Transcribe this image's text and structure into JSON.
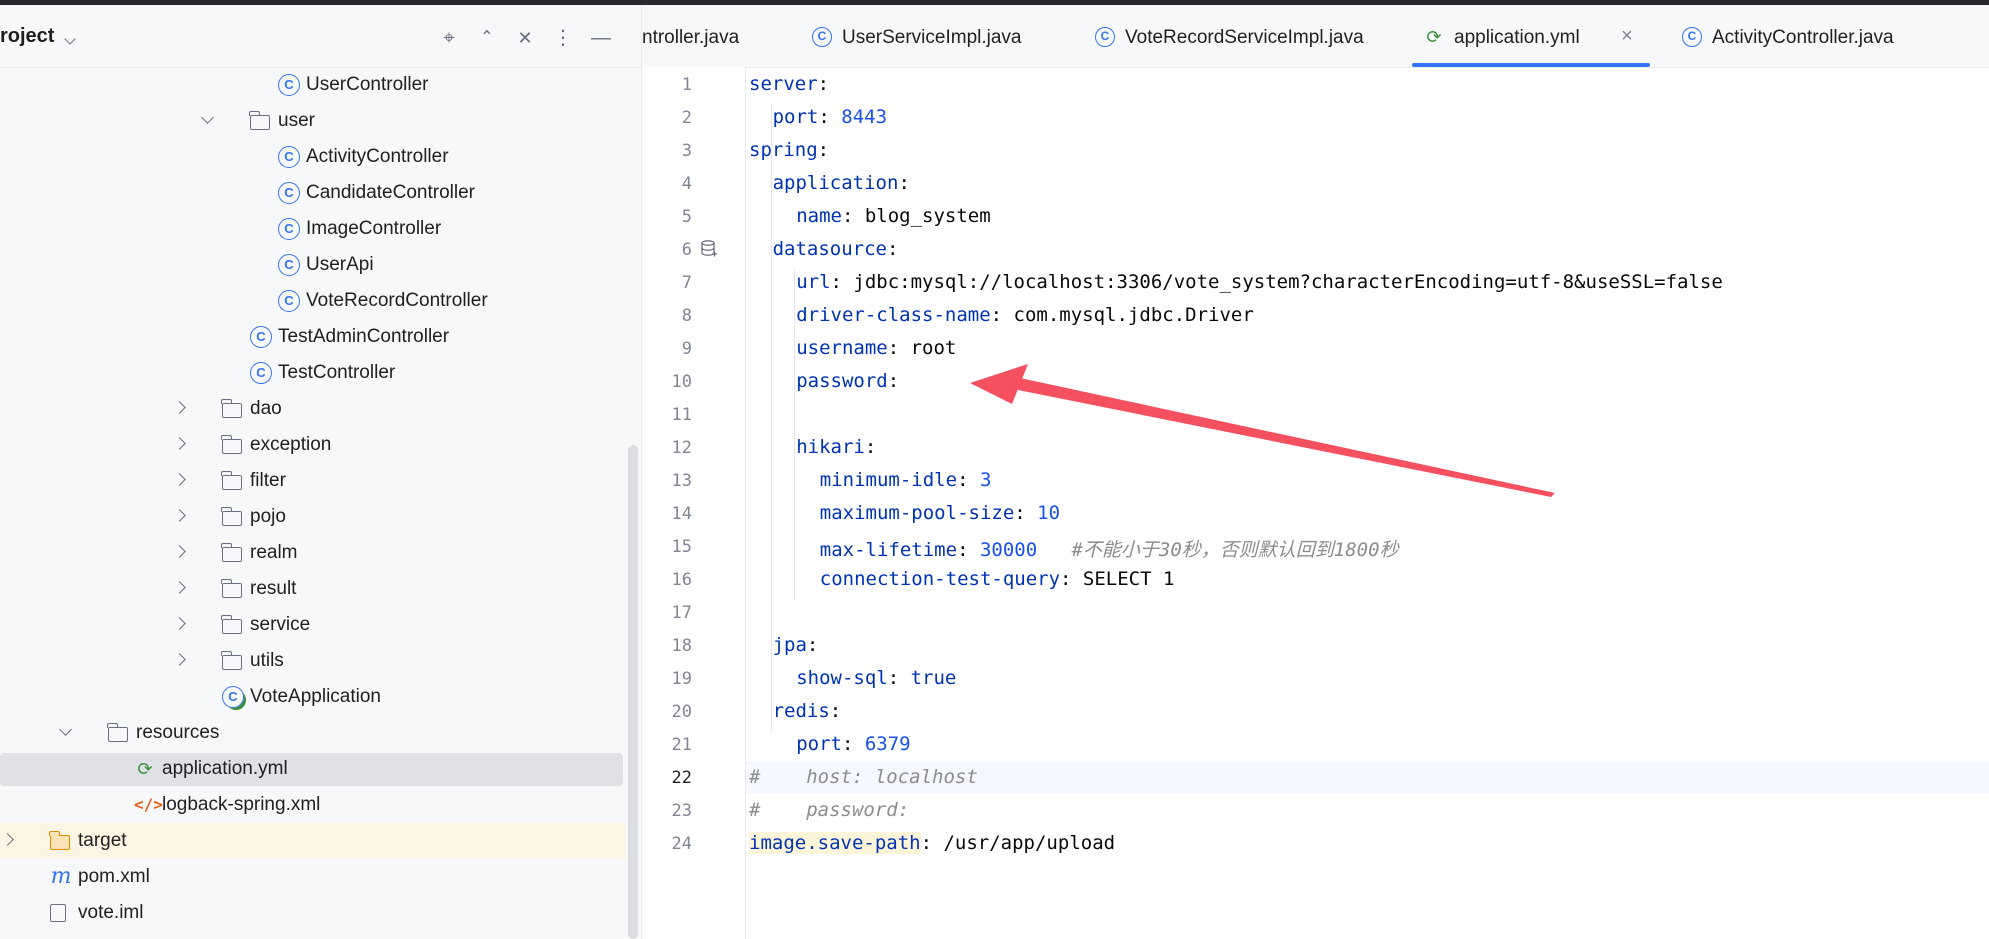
{
  "project": {
    "title": "roject",
    "tree": [
      {
        "label": "UserController",
        "icon": "class-icon",
        "kind": "class"
      },
      {
        "label": "user",
        "icon": "folder-icon",
        "kind": "folder",
        "expanded": true
      },
      {
        "label": "ActivityController",
        "icon": "class-icon",
        "kind": "class"
      },
      {
        "label": "CandidateController",
        "icon": "class-icon",
        "kind": "class"
      },
      {
        "label": "ImageController",
        "icon": "class-icon",
        "kind": "class"
      },
      {
        "label": "UserApi",
        "icon": "class-icon",
        "kind": "class"
      },
      {
        "label": "VoteRecordController",
        "icon": "class-icon",
        "kind": "class"
      },
      {
        "label": "TestAdminController",
        "icon": "class-icon",
        "kind": "class"
      },
      {
        "label": "TestController",
        "icon": "class-icon",
        "kind": "class"
      },
      {
        "label": "dao",
        "icon": "folder-icon",
        "kind": "folder",
        "expanded": false
      },
      {
        "label": "exception",
        "icon": "folder-icon",
        "kind": "folder",
        "expanded": false
      },
      {
        "label": "filter",
        "icon": "folder-icon",
        "kind": "folder",
        "expanded": false
      },
      {
        "label": "pojo",
        "icon": "folder-icon",
        "kind": "folder",
        "expanded": false
      },
      {
        "label": "realm",
        "icon": "folder-icon",
        "kind": "folder",
        "expanded": false
      },
      {
        "label": "result",
        "icon": "folder-icon",
        "kind": "folder",
        "expanded": false
      },
      {
        "label": "service",
        "icon": "folder-icon",
        "kind": "folder",
        "expanded": false
      },
      {
        "label": "utils",
        "icon": "folder-icon",
        "kind": "folder",
        "expanded": false
      },
      {
        "label": "VoteApplication",
        "icon": "spring-boot-class-icon",
        "kind": "class"
      },
      {
        "label": "resources",
        "icon": "resources-folder-icon",
        "kind": "folder",
        "expanded": true
      },
      {
        "label": "application.yml",
        "icon": "yaml-file-icon",
        "kind": "file",
        "selected": true
      },
      {
        "label": "logback-spring.xml",
        "icon": "xml-file-icon",
        "kind": "file"
      },
      {
        "label": "target",
        "icon": "excluded-folder-icon",
        "kind": "folder",
        "expanded": false
      },
      {
        "label": "pom.xml",
        "icon": "maven-icon",
        "kind": "file"
      },
      {
        "label": "vote.iml",
        "icon": "iml-file-icon",
        "kind": "file"
      }
    ]
  },
  "tabs": [
    {
      "label": "ntroller.java",
      "icon": "class-icon"
    },
    {
      "label": "UserServiceImpl.java",
      "icon": "class-icon"
    },
    {
      "label": "VoteRecordServiceImpl.java",
      "icon": "class-icon"
    },
    {
      "label": "application.yml",
      "icon": "yaml-file-icon",
      "active": true,
      "close": "×"
    },
    {
      "label": "ActivityController.java",
      "icon": "class-icon"
    }
  ],
  "editor": {
    "current_line": 22,
    "lines": [
      {
        "n": "1",
        "k": "server",
        "s": ":"
      },
      {
        "n": "2",
        "k": "port",
        "s": ": ",
        "v": "8443",
        "vt": "num"
      },
      {
        "n": "3",
        "k": "spring",
        "s": ":"
      },
      {
        "n": "4",
        "k": "application",
        "s": ":"
      },
      {
        "n": "5",
        "k": "name",
        "s": ": ",
        "v": "blog_system",
        "vt": "plain"
      },
      {
        "n": "6",
        "k": "datasource",
        "s": ":"
      },
      {
        "n": "7",
        "k": "url",
        "s": ": ",
        "v": "jdbc:mysql://localhost:3306/vote_system?characterEncoding=utf-8&useSSL=false",
        "vt": "plain"
      },
      {
        "n": "8",
        "k": "driver-class-name",
        "s": ": ",
        "v": "com.mysql.jdbc.Driver",
        "vt": "plain"
      },
      {
        "n": "9",
        "k": "username",
        "s": ": ",
        "v": "root",
        "vt": "plain"
      },
      {
        "n": "10",
        "k": "password",
        "s": ":"
      },
      {
        "n": "11"
      },
      {
        "n": "12",
        "k": "hikari",
        "s": ":"
      },
      {
        "n": "13",
        "k": "minimum-idle",
        "s": ": ",
        "v": "3",
        "vt": "num"
      },
      {
        "n": "14",
        "k": "maximum-pool-size",
        "s": ": ",
        "v": "10",
        "vt": "num"
      },
      {
        "n": "15",
        "k": "max-lifetime",
        "s": ": ",
        "v": "30000",
        "vt": "num",
        "c": "   #不能小于30秒，否则默认回到1800秒"
      },
      {
        "n": "16",
        "k": "connection-test-query",
        "s": ": ",
        "v": "SELECT 1",
        "vt": "plain"
      },
      {
        "n": "17"
      },
      {
        "n": "18",
        "k": "jpa",
        "s": ":"
      },
      {
        "n": "19",
        "k": "show-sql",
        "s": ": ",
        "v": "true",
        "vt": "kw"
      },
      {
        "n": "20",
        "k": "redis",
        "s": ":"
      },
      {
        "n": "21",
        "k": "port",
        "s": ": ",
        "v": "6379",
        "vt": "num"
      },
      {
        "n": "22",
        "c": "#    host: localhost"
      },
      {
        "n": "23",
        "c": "#    password:"
      },
      {
        "n": "24",
        "k": "image.save-path",
        "s": ": ",
        "v": "/usr/app/upload",
        "vt": "plain",
        "hl": true
      }
    ]
  },
  "colors": {
    "accent": "#3574f0",
    "yaml_key": "#0033b3",
    "number": "#1750eb",
    "comment": "#8c8c8c",
    "annotation_arrow": "#f5505f"
  }
}
